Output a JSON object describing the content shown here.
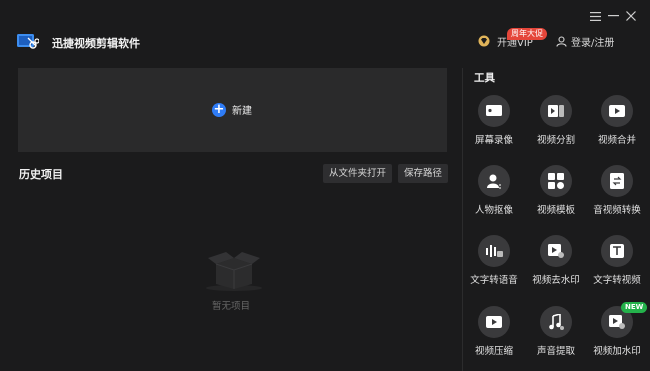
{
  "app": {
    "title": "迅捷视频剪辑软件"
  },
  "header": {
    "vip_label": "开通VIP",
    "promo_badge": "周年大促",
    "login_label": "登录/注册"
  },
  "main": {
    "new_label": "新建",
    "history_title": "历史项目",
    "open_folder_label": "从文件夹打开",
    "save_path_label": "保存路径",
    "empty_text": "暂无项目"
  },
  "tools": {
    "title": "工具",
    "new_badge": "NEW",
    "items": [
      {
        "label": "屏幕录像",
        "icon": "screen-record-icon"
      },
      {
        "label": "视频分割",
        "icon": "video-split-icon"
      },
      {
        "label": "视频合并",
        "icon": "video-merge-icon"
      },
      {
        "label": "人物抠像",
        "icon": "portrait-cutout-icon"
      },
      {
        "label": "视频模板",
        "icon": "video-template-icon"
      },
      {
        "label": "音视频转换",
        "icon": "av-convert-icon"
      },
      {
        "label": "文字转语音",
        "icon": "text-to-speech-icon"
      },
      {
        "label": "视频去水印",
        "icon": "remove-watermark-icon"
      },
      {
        "label": "文字转视频",
        "icon": "text-to-video-icon"
      },
      {
        "label": "视频压缩",
        "icon": "video-compress-icon"
      },
      {
        "label": "声音提取",
        "icon": "audio-extract-icon"
      },
      {
        "label": "视频加水印",
        "icon": "add-watermark-icon"
      }
    ]
  },
  "colors": {
    "background": "#1b1b1c",
    "panel": "#2a2a2b",
    "accent": "#2f7cf6",
    "promo": "#e5463a",
    "new_badge": "#24b24b",
    "vip_gold": "#e0b45a"
  }
}
